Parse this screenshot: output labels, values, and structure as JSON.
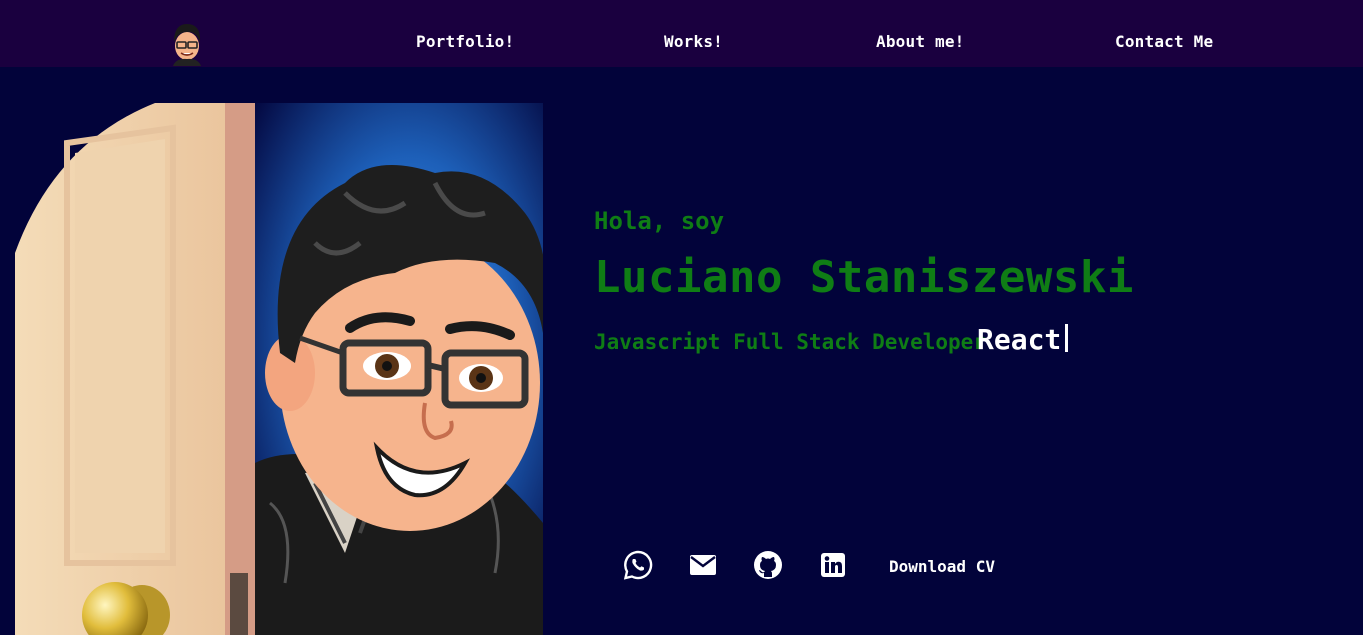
{
  "nav": {
    "links": [
      {
        "label": "Portfolio!"
      },
      {
        "label": "Works!"
      },
      {
        "label": "About me!"
      },
      {
        "label": "Contact Me"
      }
    ]
  },
  "hero": {
    "greeting": "Hola, soy",
    "name": "Luciano Staniszewski",
    "role": "Javascript Full Stack Developer",
    "typed_word": "React"
  },
  "social": {
    "icons": [
      "whatsapp-icon",
      "mail-icon",
      "github-icon",
      "linkedin-icon"
    ],
    "download_label": "Download CV"
  },
  "colors": {
    "navbar": "#1a003f",
    "background": "#02033a",
    "accent_green": "#0f7d15",
    "text": "#ffffff"
  }
}
